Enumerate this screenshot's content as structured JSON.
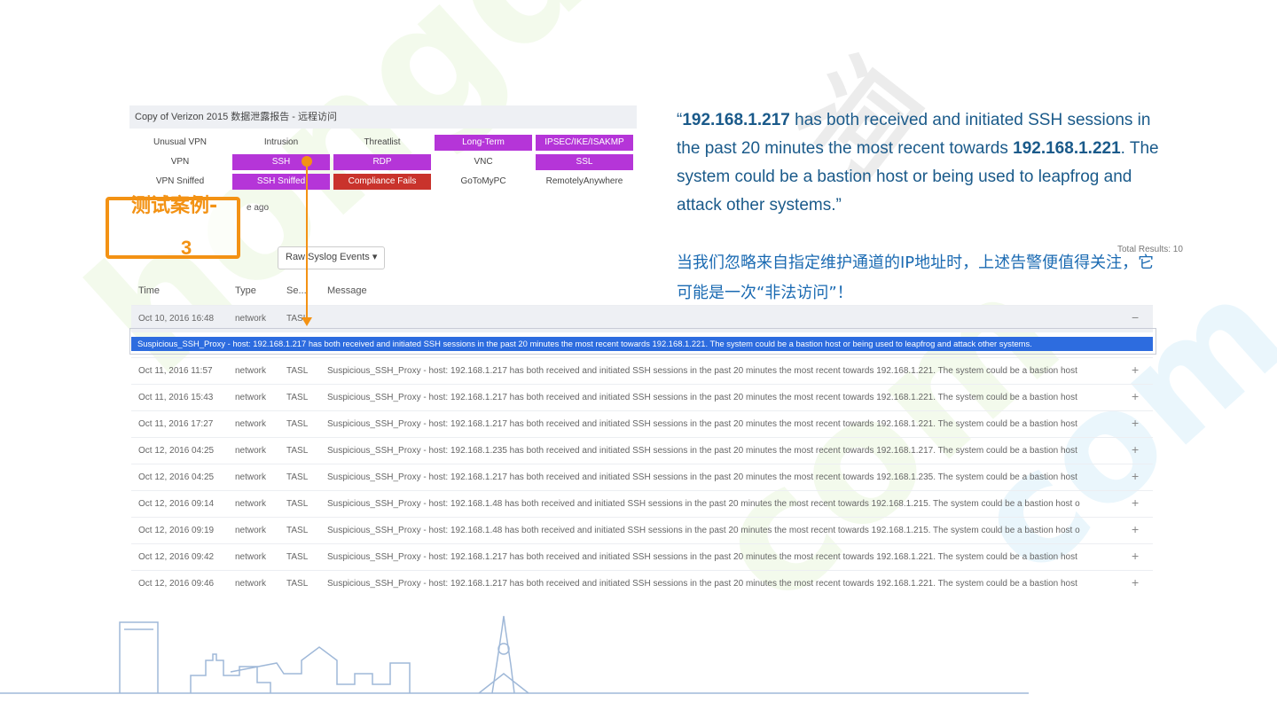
{
  "watermark": {
    "line1": "hongdo",
    "line2": "com",
    "line3": "com",
    "line4": "洞"
  },
  "panel": {
    "title": "Copy of Verizon 2015 数据泄露报告 - 远程访问",
    "grid": [
      [
        "Unusual VPN",
        "Intrusion",
        "Threatlist",
        "Long-Term",
        "IPSEC/IKE/ISAKMP"
      ],
      [
        "VPN",
        "SSH",
        "RDP",
        "VNC",
        "SSL"
      ],
      [
        "VPN Sniffed",
        "SSH Sniffed",
        "Compliance Fails",
        "GoToMyPC",
        "RemotelyAnywhere"
      ]
    ],
    "ago_text": "e ago",
    "colors": {
      "purple": "#b535d8",
      "red": "#c9332c",
      "accent": "#f39214",
      "highlight": "#2d6cdf"
    }
  },
  "annotation": {
    "label": "测试案例-",
    "number": "3"
  },
  "toolbar": {
    "raw_events": "Raw Syslog Events",
    "total": "Total Results: 10"
  },
  "table": {
    "headers": {
      "time": "Time",
      "type": "Type",
      "sev": "Se...",
      "msg": "Message"
    },
    "expanded": {
      "time": "Oct 10, 2016 16:48",
      "type": "network",
      "sev": "TASL",
      "action": "−",
      "detail": "Suspicious_SSH_Proxy - host: 192.168.1.217 has both received and initiated SSH sessions in the past 20 minutes the most recent towards 192.168.1.221. The system could be a bastion host or being used to leapfrog and attack other systems."
    },
    "rows": [
      {
        "time": "Oct 11, 2016 11:57",
        "type": "network",
        "sev": "TASL",
        "msg": "Suspicious_SSH_Proxy - host: 192.168.1.217 has both received and initiated SSH sessions in the past 20 minutes the most recent towards 192.168.1.221. The system could be a bastion host",
        "action": "+"
      },
      {
        "time": "Oct 11, 2016 15:43",
        "type": "network",
        "sev": "TASL",
        "msg": "Suspicious_SSH_Proxy - host: 192.168.1.217 has both received and initiated SSH sessions in the past 20 minutes the most recent towards 192.168.1.221. The system could be a bastion host",
        "action": "+"
      },
      {
        "time": "Oct 11, 2016 17:27",
        "type": "network",
        "sev": "TASL",
        "msg": "Suspicious_SSH_Proxy - host: 192.168.1.217 has both received and initiated SSH sessions in the past 20 minutes the most recent towards 192.168.1.221. The system could be a bastion host",
        "action": "+"
      },
      {
        "time": "Oct 12, 2016 04:25",
        "type": "network",
        "sev": "TASL",
        "msg": "Suspicious_SSH_Proxy - host: 192.168.1.235 has both received and initiated SSH sessions in the past 20 minutes the most recent towards 192.168.1.217. The system could be a bastion host",
        "action": "+"
      },
      {
        "time": "Oct 12, 2016 04:25",
        "type": "network",
        "sev": "TASL",
        "msg": "Suspicious_SSH_Proxy - host: 192.168.1.217 has both received and initiated SSH sessions in the past 20 minutes the most recent towards 192.168.1.235. The system could be a bastion host",
        "action": "+"
      },
      {
        "time": "Oct 12, 2016 09:14",
        "type": "network",
        "sev": "TASL",
        "msg": "Suspicious_SSH_Proxy - host: 192.168.1.48 has both received and initiated SSH sessions in the past 20 minutes the most recent towards 192.168.1.215. The system could be a bastion host o",
        "action": "+"
      },
      {
        "time": "Oct 12, 2016 09:19",
        "type": "network",
        "sev": "TASL",
        "msg": "Suspicious_SSH_Proxy - host: 192.168.1.48 has both received and initiated SSH sessions in the past 20 minutes the most recent towards 192.168.1.215. The system could be a bastion host o",
        "action": "+"
      },
      {
        "time": "Oct 12, 2016 09:42",
        "type": "network",
        "sev": "TASL",
        "msg": "Suspicious_SSH_Proxy - host: 192.168.1.217 has both received and initiated SSH sessions in the past 20 minutes the most recent towards 192.168.1.221. The system could be a bastion host",
        "action": "+"
      },
      {
        "time": "Oct 12, 2016 09:46",
        "type": "network",
        "sev": "TASL",
        "msg": "Suspicious_SSH_Proxy - host: 192.168.1.217 has both received and initiated SSH sessions in the past 20 minutes the most recent towards 192.168.1.221. The system could be a bastion host",
        "action": "+"
      }
    ]
  },
  "quote": {
    "open": "“",
    "ip1": "192.168.1.217",
    "mid": " has both received and initiated SSH sessions in the past 20 minutes the most recent towards ",
    "ip2": "192.168.1.221",
    "end": ". The system could be a bastion host or being used to leapfrog and attack other systems.”"
  },
  "note_cn": "当我们忽略来自指定维护通道的IP地址时，上述告警便值得关注，它可能是一次“非法访问”！"
}
